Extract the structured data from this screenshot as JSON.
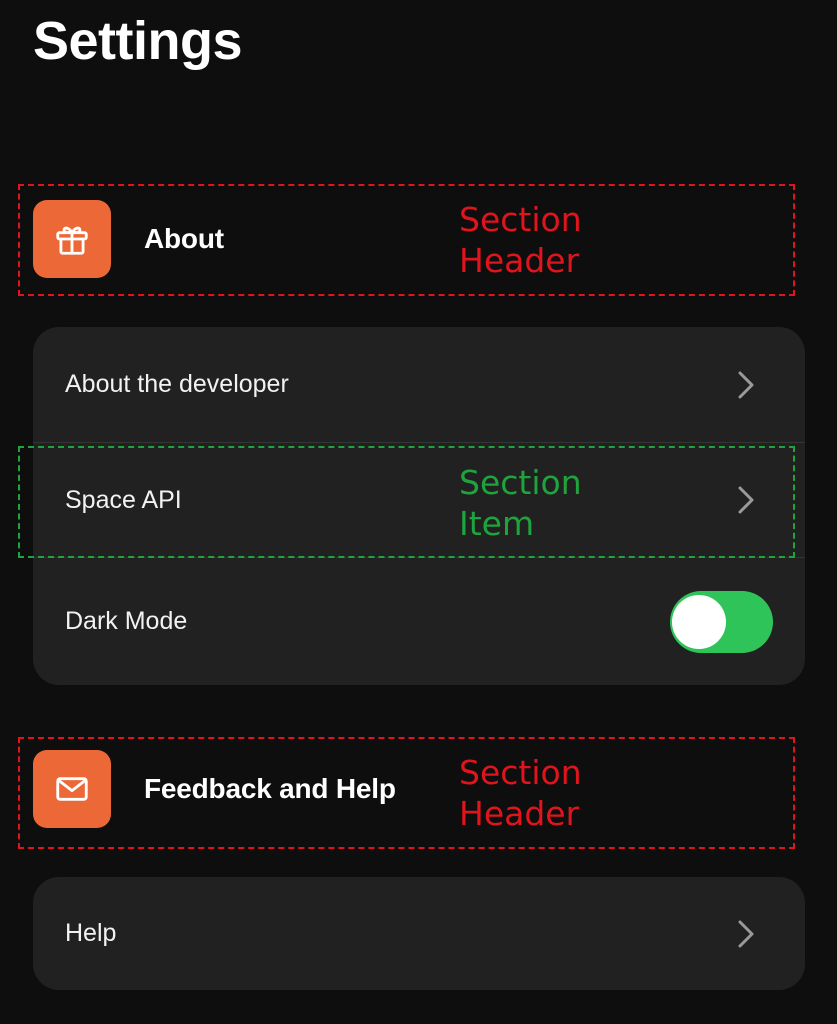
{
  "page": {
    "title": "Settings"
  },
  "sections": [
    {
      "header": {
        "label": "About",
        "icon": "gift-icon"
      },
      "items": [
        {
          "label": "About the developer",
          "control": "chevron"
        },
        {
          "label": "Space API",
          "control": "chevron"
        },
        {
          "label": "Dark Mode",
          "control": "toggle",
          "value": true
        }
      ]
    },
    {
      "header": {
        "label": "Feedback and Help",
        "icon": "mail-icon"
      },
      "items": [
        {
          "label": "Help",
          "control": "chevron"
        }
      ]
    }
  ],
  "annotations": {
    "section_header_1": "Section\nHeader",
    "section_item": "Section\nItem",
    "section_header_2": "Section\nHeader"
  },
  "colors": {
    "background": "#0e0e0e",
    "card": "#212121",
    "accent_orange": "#ec6837",
    "toggle_on": "#2fc45a",
    "annotation_red": "#e0141c",
    "annotation_green": "#1ea43c"
  }
}
